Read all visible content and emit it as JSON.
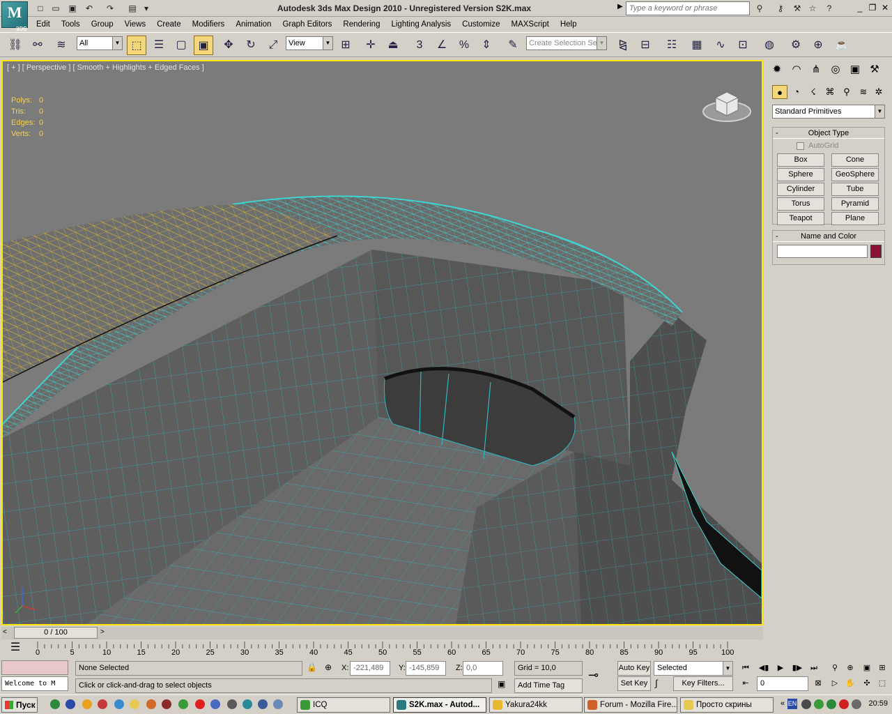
{
  "titlebar": {
    "title": "Autodesk 3ds Max Design 2010   -   Unregistered Version     S2K.max",
    "search_placeholder": "Type a keyword or phrase",
    "logo_text": "M",
    "logo_sub": "3DS"
  },
  "menu": [
    "Edit",
    "Tools",
    "Group",
    "Views",
    "Create",
    "Modifiers",
    "Animation",
    "Graph Editors",
    "Rendering",
    "Lighting Analysis",
    "Customize",
    "MAXScript",
    "Help"
  ],
  "toolbar": {
    "filter_value": "All",
    "ref_coord_value": "View",
    "selection_set_placeholder": "Create Selection Se"
  },
  "viewport": {
    "label": "[ + ] [ Perspective ] [ Smooth + Highlights + Edged Faces ]",
    "stats": [
      {
        "label": "Polys:",
        "value": "0"
      },
      {
        "label": "Tris:",
        "value": "0"
      },
      {
        "label": "Edges:",
        "value": "0"
      },
      {
        "label": "Verts:",
        "value": "0"
      }
    ]
  },
  "command_panel": {
    "primitives_value": "Standard Primitives",
    "object_type_title": "Object Type",
    "autogrid_label": "AutoGrid",
    "object_buttons": [
      "Box",
      "Cone",
      "Sphere",
      "GeoSphere",
      "Cylinder",
      "Tube",
      "Torus",
      "Pyramid",
      "Teapot",
      "Plane"
    ],
    "name_color_title": "Name and Color",
    "object_color": "#8a1238"
  },
  "timeline": {
    "frame_display": "0 / 100",
    "ticks": [
      "0",
      "5",
      "10",
      "15",
      "20",
      "25",
      "30",
      "35",
      "40",
      "45",
      "50",
      "55",
      "60",
      "65",
      "70",
      "75",
      "80",
      "85",
      "90",
      "95",
      "100"
    ]
  },
  "status": {
    "listener_text": "Welcome to M",
    "selection_status": "None Selected",
    "prompt": "Click or click-and-drag to select objects",
    "x_label": "X:",
    "x_value": "-221,489",
    "y_label": "Y:",
    "y_value": "-145,859",
    "z_label": "Z:",
    "z_value": "0,0",
    "grid": "Grid = 10,0",
    "add_time_tag": "Add Time Tag",
    "auto_key": "Auto Key",
    "set_key": "Set Key",
    "key_mode_value": "Selected",
    "key_filters": "Key Filters...",
    "current_frame": "0"
  },
  "taskbar": {
    "start_label": "Пуск",
    "tasks": [
      {
        "label": "ICQ",
        "color": "#3a9a3a"
      },
      {
        "label": "S2K.max - Autod...",
        "color": "#2a7a80"
      },
      {
        "label": "Yakura24kk",
        "color": "#e8b830"
      },
      {
        "label": "Forum - Mozilla Fire...",
        "color": "#d0602a"
      },
      {
        "label": "Просто скрины",
        "color": "#e8c850"
      }
    ],
    "lang": "EN",
    "clock": "20:59"
  }
}
